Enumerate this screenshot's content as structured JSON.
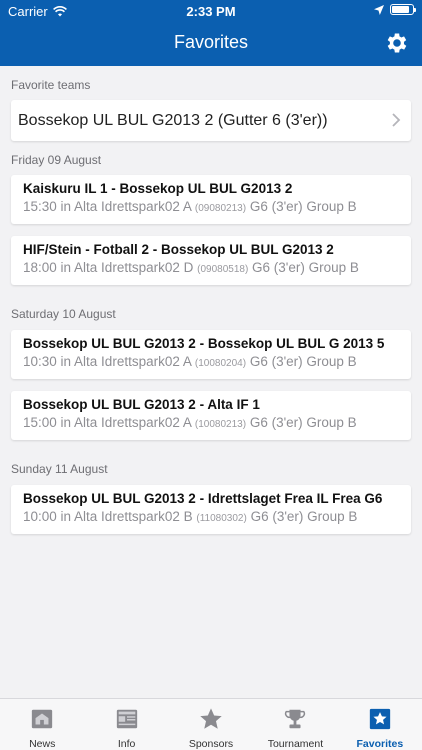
{
  "status_bar": {
    "carrier": "Carrier",
    "time": "2:33 PM"
  },
  "nav": {
    "title": "Favorites"
  },
  "favorite_teams": {
    "header": "Favorite teams",
    "items": [
      {
        "name": "Bossekop UL BUL G2013 2 (Gutter 6 (3'er))"
      }
    ]
  },
  "days": [
    {
      "header": "Friday 09 August",
      "matches": [
        {
          "title": "Kaiskuru IL 1 - Bossekop UL BUL G2013 2",
          "time_place": "15:30 in Alta Idrettspark02 A",
          "code": "(09080213)",
          "group": "G6 (3'er) Group B"
        },
        {
          "title": "HIF/Stein - Fotball 2 - Bossekop UL BUL G2013 2",
          "time_place": "18:00 in Alta Idrettspark02 D",
          "code": "(09080518)",
          "group": "G6 (3'er) Group B"
        }
      ]
    },
    {
      "header": "Saturday 10 August",
      "matches": [
        {
          "title": "Bossekop UL BUL G2013 2 - Bossekop UL BUL G 2013 5",
          "time_place": "10:30 in Alta Idrettspark02 A",
          "code": "(10080204)",
          "group": "G6 (3'er) Group B"
        },
        {
          "title": "Bossekop UL BUL G2013 2 - Alta IF 1",
          "time_place": "15:00 in Alta Idrettspark02 A",
          "code": "(10080213)",
          "group": "G6 (3'er) Group B"
        }
      ]
    },
    {
      "header": "Sunday 11 August",
      "matches": [
        {
          "title": "Bossekop UL BUL G2013 2 - Idrettslaget Frea IL Frea G6",
          "time_place": "10:00 in Alta Idrettspark02 B",
          "code": "(11080302)",
          "group": "G6 (3'er) Group B"
        }
      ]
    }
  ],
  "tabs": [
    {
      "label": "News",
      "icon": "news-icon"
    },
    {
      "label": "Info",
      "icon": "info-icon"
    },
    {
      "label": "Sponsors",
      "icon": "star-icon"
    },
    {
      "label": "Tournament",
      "icon": "trophy-icon"
    },
    {
      "label": "Favorites",
      "icon": "favorites-star-icon"
    }
  ],
  "colors": {
    "accent": "#0b5fb0",
    "background": "#f2f2f4",
    "muted_text": "#8e8e93"
  }
}
